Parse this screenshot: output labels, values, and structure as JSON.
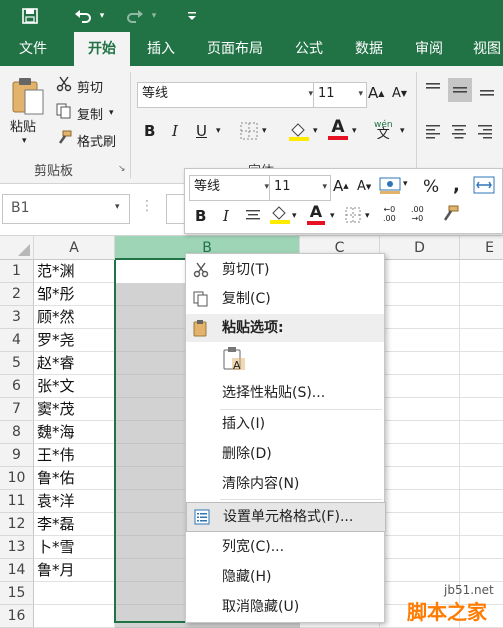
{
  "colors": {
    "brand": "#217346",
    "ribbon_bg": "#f3f3f3",
    "selected_col": "#9fd5b7",
    "font_red": "#e81123",
    "highlight_yellow": "#ffeb00"
  },
  "qat": {
    "icons": [
      "save-icon",
      "undo-icon",
      "redo-icon",
      "customize-icon"
    ]
  },
  "tabs": [
    {
      "label": "文件",
      "active": false
    },
    {
      "label": "开始",
      "active": true
    },
    {
      "label": "插入",
      "active": false
    },
    {
      "label": "页面布局",
      "active": false
    },
    {
      "label": "公式",
      "active": false
    },
    {
      "label": "数据",
      "active": false
    },
    {
      "label": "审阅",
      "active": false
    },
    {
      "label": "视图",
      "active": false
    }
  ],
  "ribbon": {
    "paste_label": "粘贴",
    "cut_label": "剪切",
    "copy_label": "复制",
    "format_painter_label": "格式刷",
    "clipboard_group": "剪贴板",
    "font_name": "等线",
    "font_size": "11",
    "font_group": "字体",
    "bold": "B",
    "italic": "I",
    "underline": "U",
    "font_color_glyph": "A",
    "grow_font": "A",
    "shrink_font": "A",
    "wen_glyph": "wén"
  },
  "formula_bar": {
    "name_box": "B1"
  },
  "mini_toolbar": {
    "font_name": "等线",
    "font_size": "11",
    "percent": "%",
    "comma": ",",
    "bold": "B",
    "italic": "I",
    "inc_decimal": ".00",
    "dec_decimal": ".00",
    "grow_font": "A",
    "shrink_font": "A",
    "font_color_glyph": "A"
  },
  "grid": {
    "columns": [
      "A",
      "B",
      "C",
      "D",
      "E"
    ],
    "selected_column": "B",
    "rows": [
      {
        "num": "1",
        "a": "范*渊"
      },
      {
        "num": "2",
        "a": "邹*彤"
      },
      {
        "num": "3",
        "a": "顾*然"
      },
      {
        "num": "4",
        "a": "罗*尧"
      },
      {
        "num": "5",
        "a": "赵*睿"
      },
      {
        "num": "6",
        "a": "张*文"
      },
      {
        "num": "7",
        "a": "窦*茂"
      },
      {
        "num": "8",
        "a": "魏*海"
      },
      {
        "num": "9",
        "a": "王*伟"
      },
      {
        "num": "10",
        "a": "鲁*佑"
      },
      {
        "num": "11",
        "a": "袁*洋"
      },
      {
        "num": "12",
        "a": "李*磊"
      },
      {
        "num": "13",
        "a": "卜*雪"
      },
      {
        "num": "14",
        "a": "鲁*月"
      },
      {
        "num": "15",
        "a": ""
      },
      {
        "num": "16",
        "a": ""
      }
    ]
  },
  "context_menu": {
    "cut": "剪切(T)",
    "copy": "复制(C)",
    "paste_options": "粘贴选项:",
    "paste_special": "选择性粘贴(S)...",
    "insert": "插入(I)",
    "delete": "删除(D)",
    "clear": "清除内容(N)",
    "format_cells": "设置单元格格式(F)...",
    "col_width": "列宽(C)...",
    "hide": "隐藏(H)",
    "unhide": "取消隐藏(U)"
  },
  "watermark": {
    "site": "jb51.net",
    "brand": "脚本之家"
  }
}
